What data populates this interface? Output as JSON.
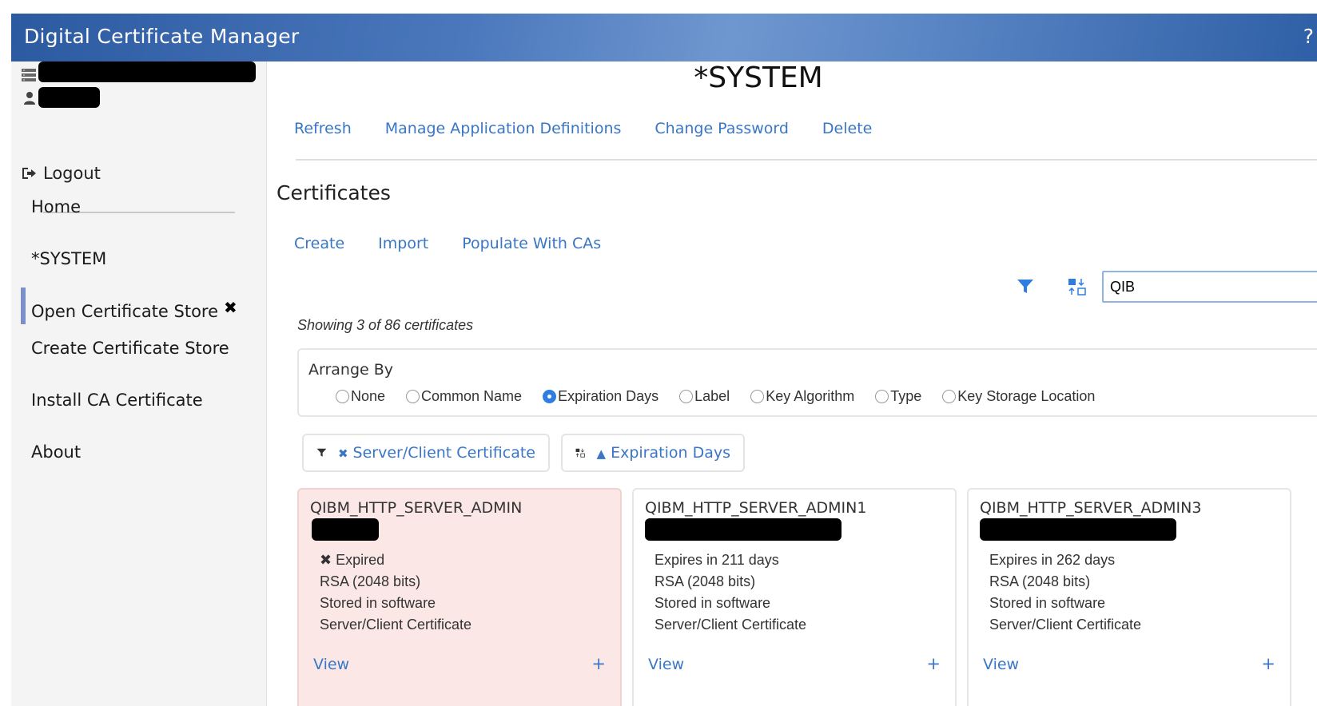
{
  "app": {
    "title": "Digital Certificate Manager",
    "help_label": "?"
  },
  "sidebar": {
    "logout_label": "Logout",
    "items": [
      {
        "label": "Home"
      },
      {
        "label": "*SYSTEM",
        "active": true,
        "close_glyph": "✖"
      },
      {
        "label": "Open Certificate Store"
      },
      {
        "label": "Create Certificate Store"
      },
      {
        "label": "Install CA Certificate"
      },
      {
        "label": "About"
      }
    ]
  },
  "main": {
    "title": "*SYSTEM",
    "links": [
      "Refresh",
      "Manage Application Definitions",
      "Change Password",
      "Delete"
    ],
    "section_title": "Certificates",
    "actions": [
      "Create",
      "Import",
      "Populate With CAs"
    ],
    "search": {
      "value": "QIB"
    },
    "showing_text": "Showing 3 of 86 certificates",
    "arrange": {
      "label": "Arrange By",
      "options": [
        "None",
        "Common Name",
        "Expiration Days",
        "Label",
        "Key Algorithm",
        "Type",
        "Key Storage Location"
      ],
      "selected": "Expiration Days"
    },
    "chips": {
      "filter": {
        "prefix": "✖",
        "label": "Server/Client Certificate"
      },
      "sort": {
        "prefix": "▲",
        "label": "Expiration Days"
      }
    },
    "cards": [
      {
        "name": "QIBM_HTTP_SERVER_ADMIN",
        "status": "✖ Expired",
        "algorithm": "RSA (2048 bits)",
        "storage": "Stored in software",
        "type": "Server/Client Certificate",
        "view_label": "View",
        "expand_label": "+",
        "expired": true
      },
      {
        "name": "QIBM_HTTP_SERVER_ADMIN1",
        "status": "Expires in 211 days",
        "algorithm": "RSA (2048 bits)",
        "storage": "Stored in software",
        "type": "Server/Client Certificate",
        "view_label": "View",
        "expand_label": "+",
        "expired": false
      },
      {
        "name": "QIBM_HTTP_SERVER_ADMIN3",
        "status": "Expires in 262 days",
        "algorithm": "RSA (2048 bits)",
        "storage": "Stored in software",
        "type": "Server/Client Certificate",
        "view_label": "View",
        "expand_label": "+",
        "expired": false
      }
    ]
  },
  "colors": {
    "link": "#3a76c6",
    "titlebar": "#2c5aa0",
    "expired_card": "#fbe8e6",
    "active_nav": "#7b8fc9"
  },
  "icons": {
    "store": "server-icon",
    "user": "user-icon",
    "logout": "logout-icon",
    "filter": "filter-icon",
    "sort": "sort-icon"
  }
}
